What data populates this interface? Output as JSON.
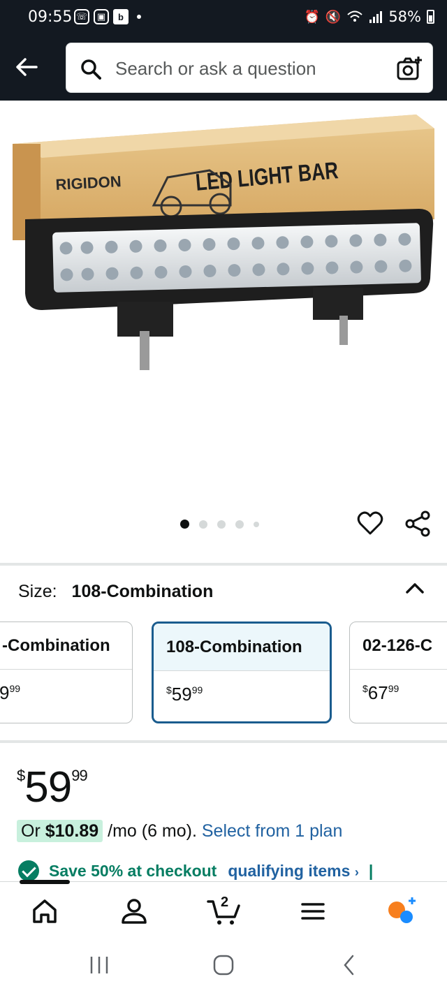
{
  "status_bar": {
    "time": "09:55",
    "battery": "58%",
    "icons": [
      "phone-icon",
      "gallery-icon",
      "b-icon",
      "alarm-icon",
      "mute-icon",
      "wifi-icon",
      "signal-icon",
      "battery-icon"
    ]
  },
  "search": {
    "placeholder": "Search or ask a question"
  },
  "product_image": {
    "brand": "RIGIDON",
    "box_text": "LED LIGHT BAR",
    "carousel_count": 5,
    "carousel_active": 1
  },
  "size": {
    "label": "Size:",
    "selected": "108-Combination",
    "options": [
      {
        "name": "-Combination",
        "price_dollars": "9",
        "price_cents": "99",
        "currency": ""
      },
      {
        "name": "108-Combination",
        "price_dollars": "59",
        "price_cents": "99",
        "currency": "$"
      },
      {
        "name": "02-126-C",
        "price_dollars": "67",
        "price_cents": "99",
        "currency": "$"
      }
    ]
  },
  "price": {
    "currency": "$",
    "dollars": "59",
    "cents": "99"
  },
  "installment": {
    "prefix": "Or ",
    "amount": "$10.89",
    "suffix": " /mo (6 mo). ",
    "link": "Select from 1 plan"
  },
  "save": {
    "text": "Save 50% at checkout",
    "link": "qualifying items",
    "chevron": "›",
    "bar": "|"
  },
  "bottom_nav": {
    "cart_count": "2",
    "items": [
      "home-icon",
      "account-icon",
      "cart-icon",
      "menu-icon",
      "rufus-icon"
    ]
  },
  "colors": {
    "header_bg": "#131921",
    "selected_border": "#1a5c8e",
    "link": "#2162a1",
    "save_green": "#067d62",
    "rufus_orange": "#f77f1e",
    "rufus_blue": "#1a8cff"
  }
}
